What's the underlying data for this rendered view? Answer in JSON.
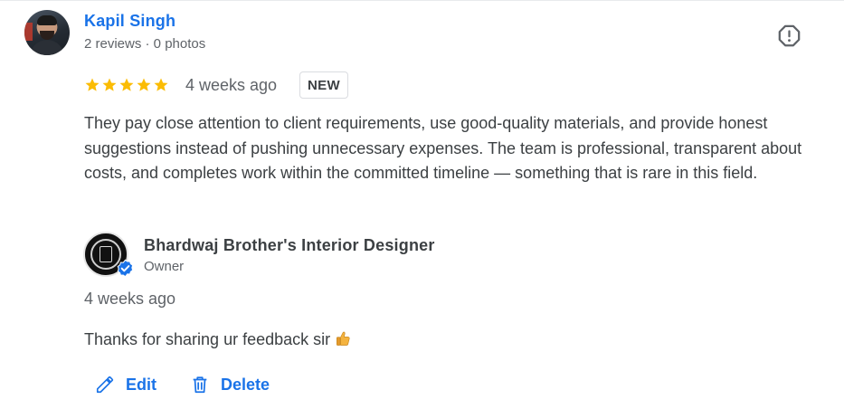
{
  "review": {
    "reviewer_name": "Kapil Singh",
    "reviewer_meta": "2 reviews · 0 photos",
    "rating": 5,
    "rating_max": 5,
    "time": "4 weeks ago",
    "badge": "NEW",
    "text": "They pay close attention to client requirements, use good-quality materials, and provide honest suggestions instead of pushing unnecessary expenses. The team is professional, transparent about costs, and completes work within the committed timeline — something that is rare in this field."
  },
  "owner_reply": {
    "name": "Bhardwaj Brother's Interior Designer",
    "role": "Owner",
    "time": "4 weeks ago",
    "text": "Thanks for sharing ur feedback sir"
  },
  "actions": {
    "edit_label": "Edit",
    "delete_label": "Delete"
  },
  "icons": {
    "report": "report-flag-icon",
    "star": "star-icon",
    "verified": "verified-check-icon",
    "thumbs_up": "thumbs-up-emoji",
    "edit": "pencil-icon",
    "delete": "trash-icon"
  },
  "colors": {
    "link_blue": "#1a73e8",
    "star_gold": "#fbbc04",
    "text_primary": "#3c4043",
    "text_secondary": "#5f6368",
    "verified_blue": "#1a73e8"
  }
}
